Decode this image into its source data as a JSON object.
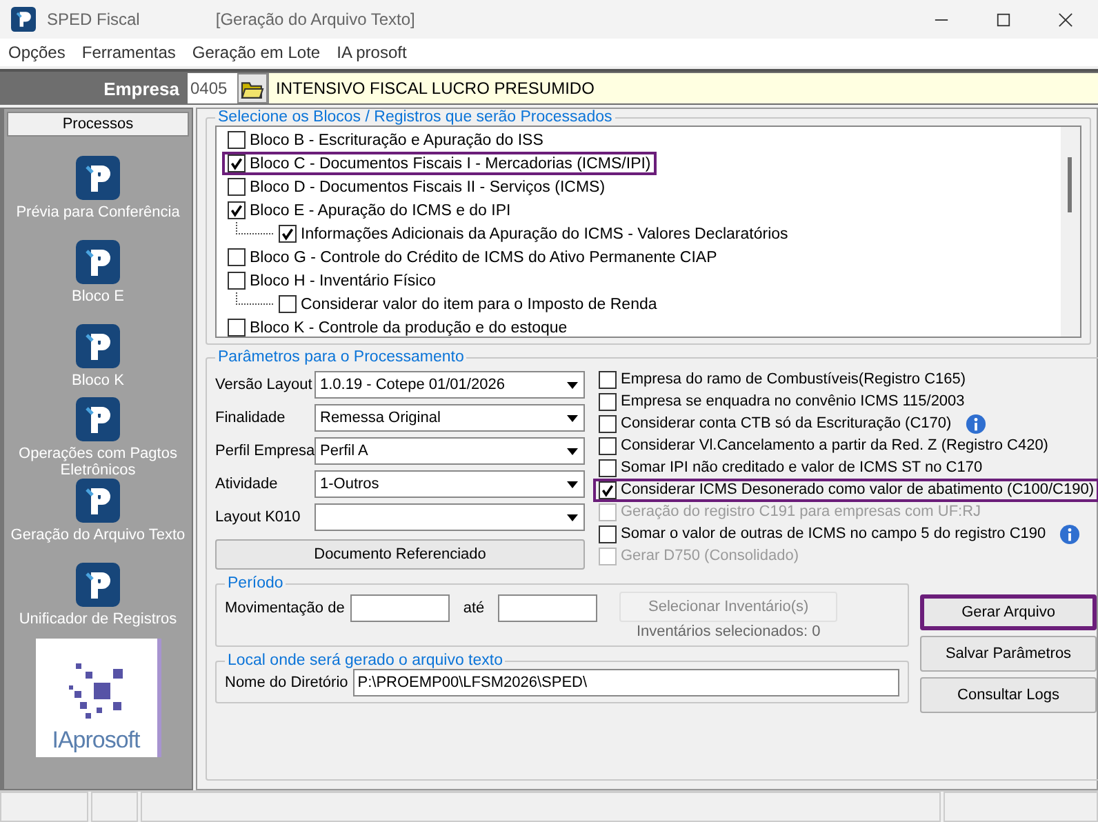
{
  "window": {
    "title": "SPED Fiscal",
    "subtitle": "[Geração do Arquivo Texto]"
  },
  "menu": [
    "Opções",
    "Ferramentas",
    "Geração em Lote",
    "IA prosoft"
  ],
  "empresa": {
    "label": "Empresa",
    "code": "0405",
    "name": "INTENSIVO FISCAL LUCRO PRESUMIDO"
  },
  "sidebar": {
    "title": "Processos",
    "items": [
      {
        "label": "Prévia para Conferência"
      },
      {
        "label": "Bloco E"
      },
      {
        "label": "Bloco K"
      },
      {
        "label": "Operações com Pagtos Eletrônicos"
      },
      {
        "label": "Geração do Arquivo Texto"
      },
      {
        "label": "Unificador de Registros"
      }
    ],
    "logo": "IAprosoft"
  },
  "blocks": {
    "title": "Selecione os Blocos / Registros que serão Processados",
    "items": [
      {
        "label": "Bloco B - Escrituração e Apuração do ISS",
        "checked": false,
        "highlighted": false
      },
      {
        "label": "Bloco C - Documentos Fiscais I - Mercadorias (ICMS/IPI)",
        "checked": true,
        "highlighted": true
      },
      {
        "label": "Bloco D - Documentos Fiscais II - Serviços (ICMS)",
        "checked": false,
        "highlighted": false
      },
      {
        "label": "Bloco E - Apuração do ICMS e do IPI",
        "checked": true,
        "highlighted": false,
        "children": [
          {
            "label": "Informações Adicionais da Apuração do ICMS - Valores Declaratórios",
            "checked": true,
            "highlighted": false
          }
        ]
      },
      {
        "label": "Bloco G - Controle do Crédito de ICMS do Ativo Permanente CIAP",
        "checked": false,
        "highlighted": false
      },
      {
        "label": "Bloco H - Inventário Físico",
        "checked": false,
        "highlighted": false,
        "children": [
          {
            "label": "Considerar valor do item para o Imposto de Renda",
            "checked": false,
            "highlighted": false
          }
        ]
      },
      {
        "label": "Bloco K - Controle da produção e do estoque",
        "checked": false,
        "highlighted": false
      }
    ]
  },
  "params": {
    "title": "Parâmetros para o Processamento",
    "fields": [
      {
        "label": "Versão Layout",
        "value": "1.0.19 - Cotepe 01/01/2026"
      },
      {
        "label": "Finalidade",
        "value": "Remessa Original"
      },
      {
        "label": "Perfil Empresa",
        "value": "Perfil A"
      },
      {
        "label": "Atividade",
        "value": "1-Outros"
      },
      {
        "label": "Layout K010"
      }
    ],
    "button": "Documento Referenciado",
    "options": [
      {
        "label": "Empresa do ramo de Combustíveis(Registro C165)",
        "checked": false,
        "disabled": false,
        "info": false,
        "highlighted": false
      },
      {
        "label": "Empresa se enquadra no convênio ICMS 115/2003",
        "checked": false,
        "disabled": false,
        "info": false,
        "highlighted": false
      },
      {
        "label": "Considerar conta CTB só da Escrituração (C170)",
        "checked": false,
        "disabled": false,
        "info": true,
        "highlighted": false
      },
      {
        "label": "Considerar Vl.Cancelamento a partir da Red. Z (Registro C420)",
        "checked": false,
        "disabled": false,
        "info": false,
        "highlighted": false
      },
      {
        "label": "Somar IPI não creditado e valor de ICMS ST no C170",
        "checked": false,
        "disabled": false,
        "info": false,
        "highlighted": false
      },
      {
        "label": "Considerar ICMS Desonerado como valor de abatimento (C100/C190)",
        "checked": true,
        "disabled": false,
        "info": false,
        "highlighted": true
      },
      {
        "label": "Geração do registro C191 para empresas com UF:RJ",
        "checked": false,
        "disabled": true,
        "info": false,
        "highlighted": false
      },
      {
        "label": "Somar o valor de outras de ICMS no campo 5 do registro C190",
        "checked": false,
        "disabled": false,
        "info": true,
        "highlighted": false
      },
      {
        "label": "Gerar D750 (Consolidado)",
        "checked": false,
        "disabled": true,
        "info": false,
        "highlighted": false
      }
    ]
  },
  "periodo": {
    "title": "Período",
    "from_label": "Movimentação de",
    "to_label": "até",
    "button": "Selecionar Inventário(s)",
    "count": "Inventários selecionados:  0"
  },
  "local": {
    "title": "Local onde será gerado o arquivo texto",
    "label": "Nome do Diretório",
    "value": "P:\\PROEMP00\\LFSM2026\\SPED\\"
  },
  "actions": [
    {
      "label": "Gerar Arquivo",
      "highlighted": true
    },
    {
      "label": "Salvar Parâmetros",
      "highlighted": false
    },
    {
      "label": "Consultar Logs",
      "highlighted": false
    }
  ]
}
